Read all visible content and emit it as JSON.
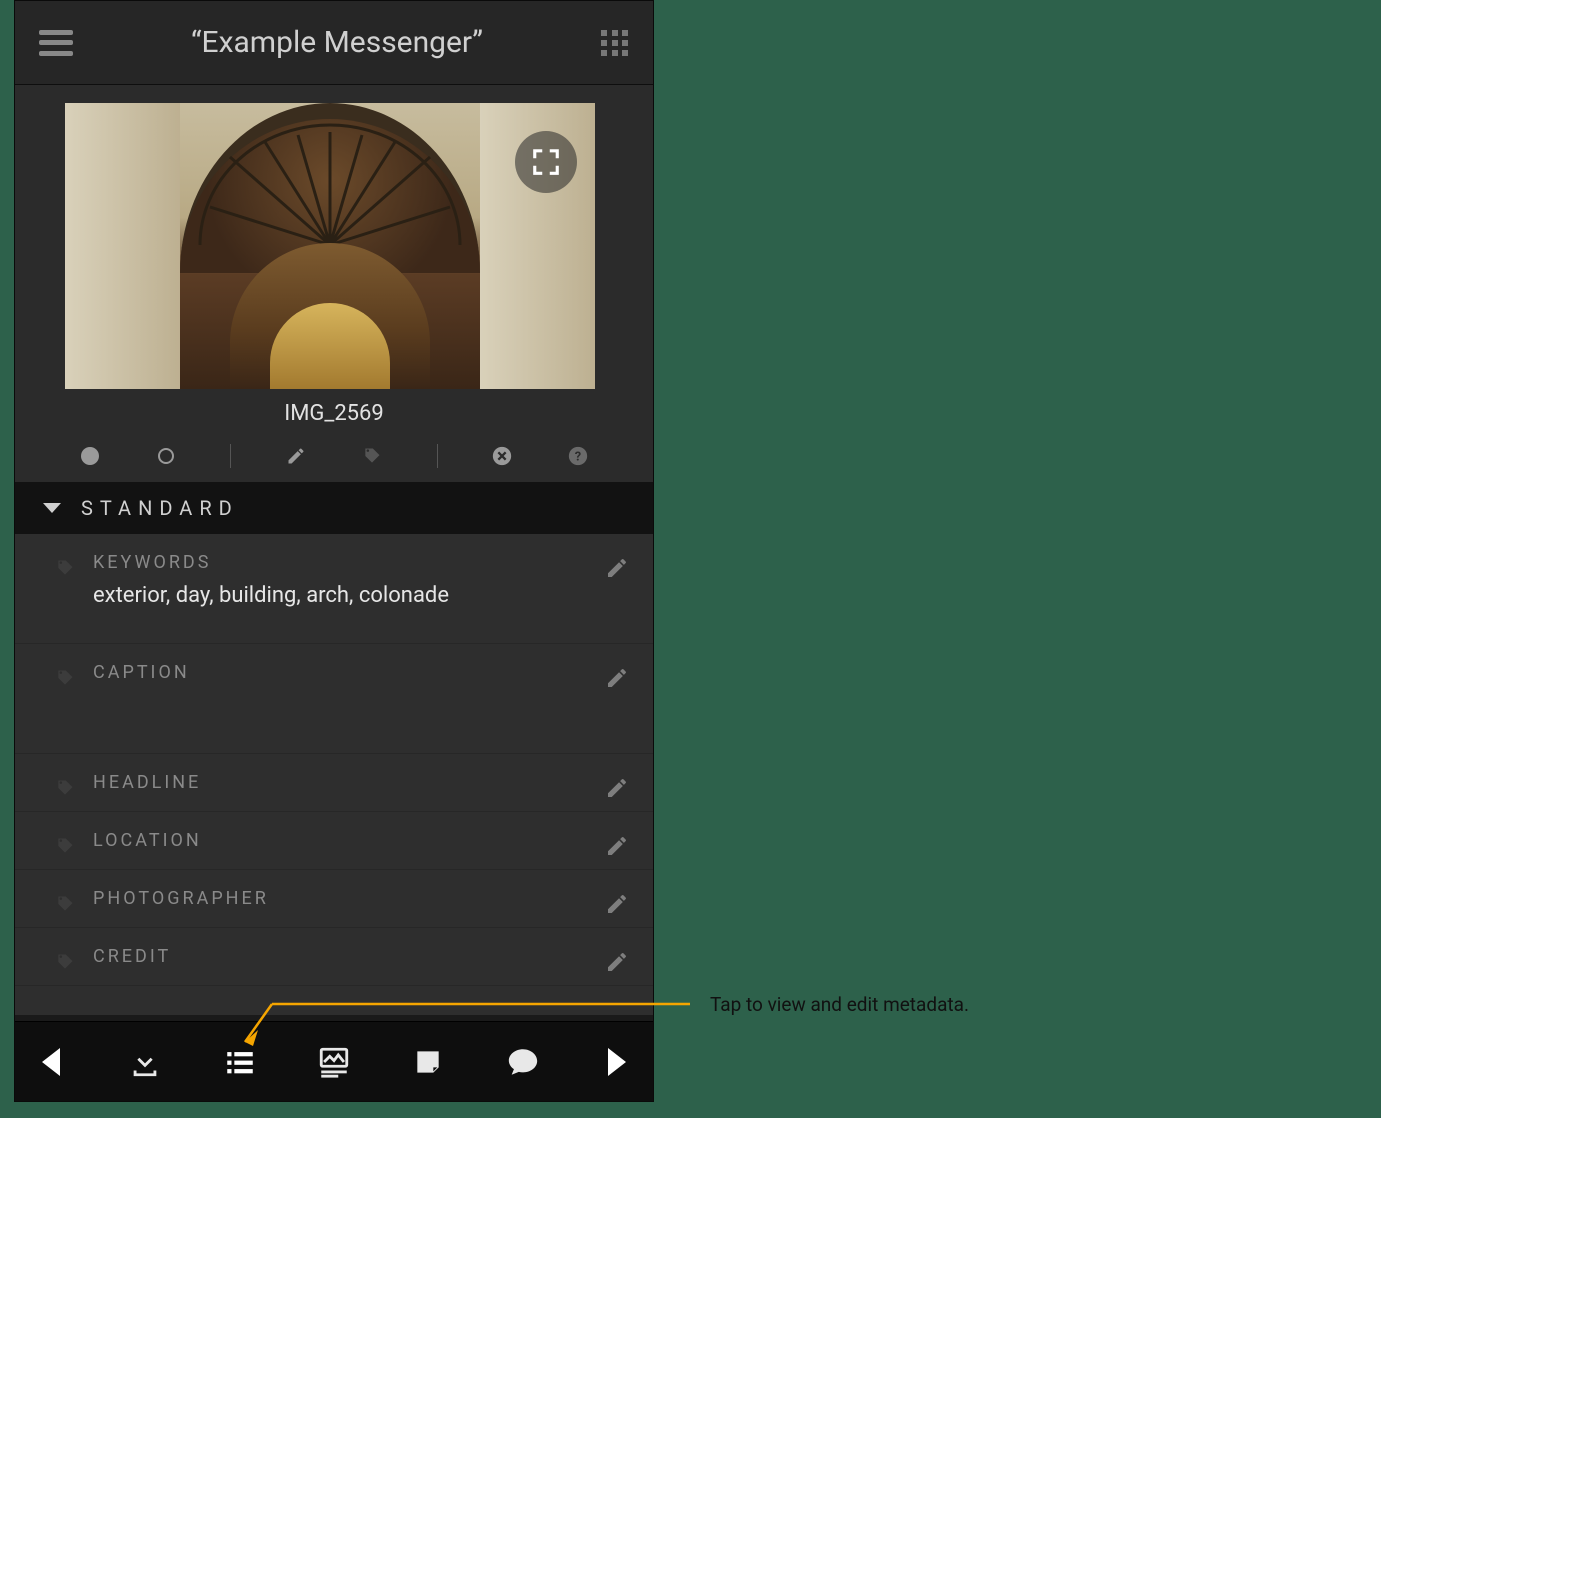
{
  "header": {
    "title": "“Example Messenger”"
  },
  "image": {
    "name": "IMG_2569"
  },
  "section": {
    "label": "STANDARD"
  },
  "metadata": [
    {
      "label": "KEYWORDS",
      "value": "exterior, day, building, arch, colonade"
    },
    {
      "label": "CAPTION",
      "value": ""
    },
    {
      "label": "HEADLINE",
      "value": ""
    },
    {
      "label": "LOCATION",
      "value": ""
    },
    {
      "label": "PHOTOGRAPHER",
      "value": ""
    },
    {
      "label": "CREDIT",
      "value": ""
    }
  ],
  "status_icons": [
    "dot-filled",
    "dot-empty",
    "pencil",
    "tag",
    "close-circle",
    "help-circle"
  ],
  "bottom_icons": [
    "download",
    "list",
    "image-caption",
    "note",
    "chat"
  ],
  "callout": "Tap to view and edit metadata.",
  "colors": {
    "accent": "#f5a500"
  }
}
